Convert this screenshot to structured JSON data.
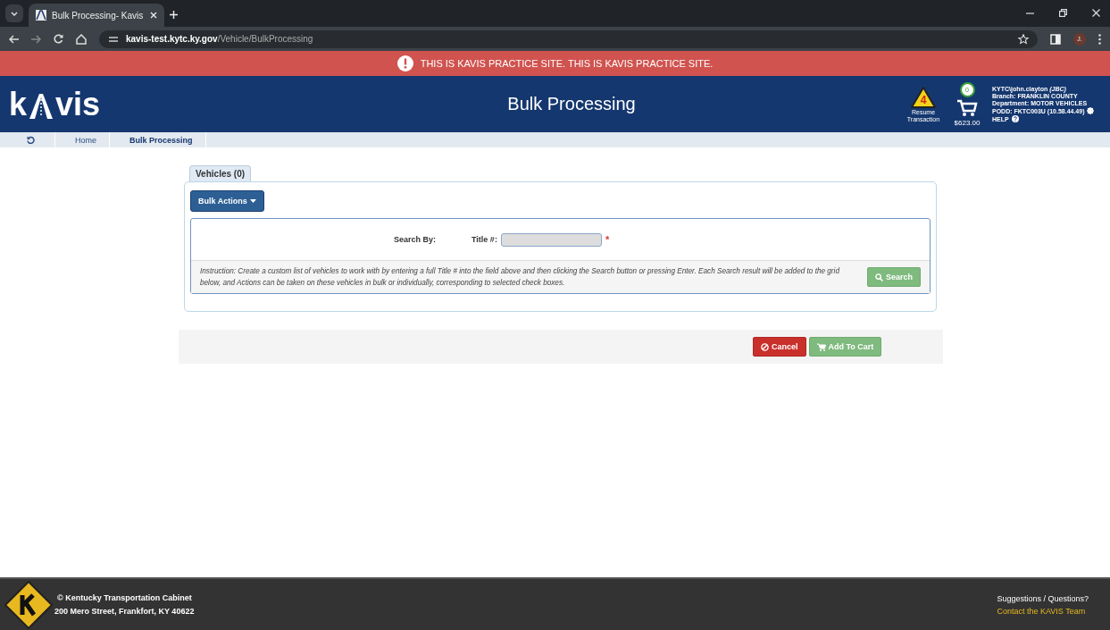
{
  "browser": {
    "tab_title": "Bulk Processing- Kavis",
    "url_host": "kavis-test.kytc.ky.gov",
    "url_path": "/Vehicle/BulkProcessing",
    "profile_initial": "J."
  },
  "alert": {
    "text": "THIS IS KAVIS PRACTICE SITE. THIS IS KAVIS PRACTICE SITE."
  },
  "header": {
    "logo_start": "k",
    "logo_end": "vis",
    "title": "Bulk Processing",
    "resume_count": "4",
    "resume_label": "Resume Transaction",
    "cart_count": "0",
    "cart_total": "$623.00",
    "user_lines": [
      "KYTC\\john.clayton *(JBC)*",
      "Branch: FRANKLIN COUNTY",
      "Department: MOTOR VEHICLES",
      "PODD: FKTC003U (10.58.44.49)"
    ],
    "help": "HELP"
  },
  "breadcrumb": [
    {
      "label": "Home",
      "selected": false
    },
    {
      "label": "Bulk Processing",
      "selected": true
    }
  ],
  "tabs": [
    {
      "label": "Vehicles (0)",
      "selected": true
    }
  ],
  "bulk_actions": "Bulk Actions",
  "search": {
    "search_by": "Search By:",
    "field_label": "Title #:",
    "required": true,
    "required_mark": "*",
    "instruction": "Instruction: Create a custom list of vehicles to work with by entering a full Title # into the field above and then clicking the Search button or pressing Enter. Each Search result will be added to the grid below, and Actions can be taken on these vehicles in bulk or individually, corresponding to selected check boxes.",
    "button": "Search"
  },
  "actions": [
    {
      "label": "Cancel",
      "kind": "cancel"
    },
    {
      "label": "Add To Cart",
      "kind": "cart"
    }
  ],
  "footer": {
    "org": "© Kentucky Transportation Cabinet",
    "address": "200 Mero Street, Frankfort, KY 40622",
    "prompt": "Suggestions / Questions?",
    "link": "Contact the KAVIS Team"
  }
}
